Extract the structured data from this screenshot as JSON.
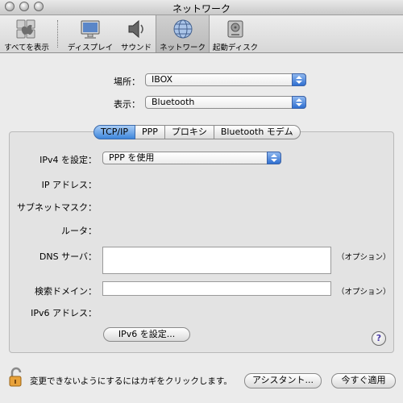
{
  "window": {
    "title": "ネットワーク"
  },
  "toolbar": {
    "items": [
      {
        "label": "すべてを表示",
        "icon": "apple-logo-icon"
      },
      {
        "label": "ディスプレイ",
        "icon": "display-icon"
      },
      {
        "label": "サウンド",
        "icon": "speaker-icon"
      },
      {
        "label": "ネットワーク",
        "icon": "globe-icon",
        "selected": true
      },
      {
        "label": "起動ディスク",
        "icon": "hard-disk-icon"
      }
    ]
  },
  "location": {
    "label": "場所：",
    "value": "IBOX"
  },
  "show": {
    "label": "表示：",
    "value": "Bluetooth"
  },
  "tabs": [
    "TCP/IP",
    "PPP",
    "プロキシ",
    "Bluetooth モデム"
  ],
  "active_tab": "TCP/IP",
  "tcpip": {
    "ipv4_label": "IPv4 を設定：",
    "ipv4_value": "PPP を使用",
    "ip_address_label": "IP アドレス：",
    "subnet_label": "サブネットマスク：",
    "router_label": "ルータ：",
    "dns_label": "DNS サーバ：",
    "dns_option": "（オプション）",
    "search_domain_label": "検索ドメイン：",
    "search_domain_option": "（オプション）",
    "ipv6_label": "IPv6 アドレス：",
    "ipv6_button": "IPv6 を設定..."
  },
  "help": "?",
  "footer": {
    "lock_text": "変更できないようにするにはカギをクリックします。",
    "assistant_button": "アシスタント...",
    "apply_button": "今すぐ適用"
  },
  "colors": {
    "accent": "#3d86dc",
    "window_bg": "#ebebeb",
    "lock": "#e8a23a"
  }
}
